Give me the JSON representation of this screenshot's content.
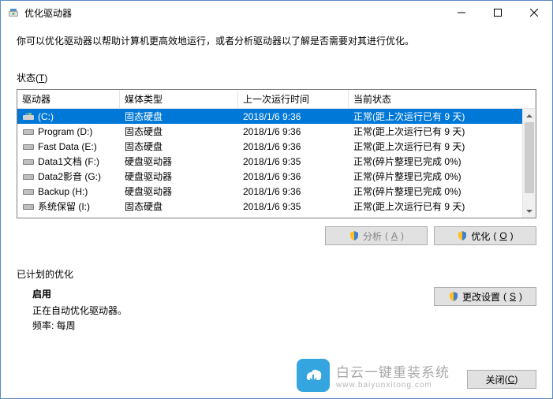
{
  "window": {
    "title": "优化驱动器"
  },
  "description": "你可以优化驱动器以帮助计算机更高效地运行，或者分析驱动器以了解是否需要对其进行优化。",
  "status": {
    "label": "状态",
    "label_key": "T"
  },
  "table": {
    "headers": {
      "drive": "驱动器",
      "type": "媒体类型",
      "last_run": "上一次运行时间",
      "status": "当前状态"
    },
    "rows": [
      {
        "drive": "(C:)",
        "type": "固态硬盘",
        "last_run": "2018/1/6 9:36",
        "status": "正常(距上次运行已有 9 天)",
        "selected": true,
        "icon": "os"
      },
      {
        "drive": "Program (D:)",
        "type": "固态硬盘",
        "last_run": "2018/1/6 9:36",
        "status": "正常(距上次运行已有 9 天)",
        "selected": false,
        "icon": "hdd"
      },
      {
        "drive": "Fast Data (E:)",
        "type": "固态硬盘",
        "last_run": "2018/1/6 9:36",
        "status": "正常(距上次运行已有 9 天)",
        "selected": false,
        "icon": "hdd"
      },
      {
        "drive": "Data1文档 (F:)",
        "type": "硬盘驱动器",
        "last_run": "2018/1/6 9:35",
        "status": "正常(碎片整理已完成 0%)",
        "selected": false,
        "icon": "hdd"
      },
      {
        "drive": "Data2影音 (G:)",
        "type": "硬盘驱动器",
        "last_run": "2018/1/6 9:36",
        "status": "正常(碎片整理已完成 0%)",
        "selected": false,
        "icon": "hdd"
      },
      {
        "drive": "Backup (H:)",
        "type": "硬盘驱动器",
        "last_run": "2018/1/6 9:36",
        "status": "正常(碎片整理已完成 0%)",
        "selected": false,
        "icon": "hdd"
      },
      {
        "drive": "系统保留 (I:)",
        "type": "固态硬盘",
        "last_run": "2018/1/6 9:35",
        "status": "正常(距上次运行已有 9 天)",
        "selected": false,
        "icon": "hdd"
      }
    ]
  },
  "buttons": {
    "analyze": "分析",
    "analyze_key": "A",
    "optimize": "优化",
    "optimize_key": "O",
    "change_settings": "更改设置",
    "change_settings_key": "S",
    "close": "关闭",
    "close_key": "C"
  },
  "scheduled": {
    "label": "已计划的优化",
    "enabled": "启用",
    "auto_text": "正在自动优化驱动器。",
    "frequency": "频率: 每周"
  },
  "watermark": {
    "title": "白云一键重装系统",
    "url": "www.baiyunxitong.com"
  }
}
